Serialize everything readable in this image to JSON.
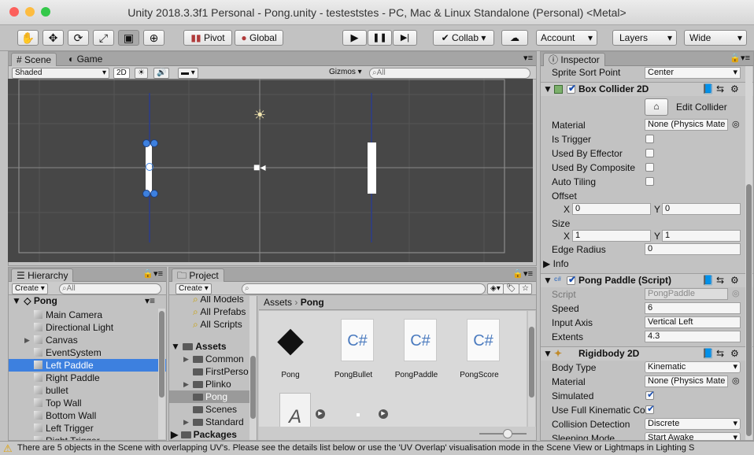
{
  "window": {
    "title": "Unity 2018.3.3f1 Personal - Pong.unity - testeststes - PC, Mac & Linux Standalone (Personal) <Metal>"
  },
  "colors": {
    "close": "#fc605c",
    "minimize": "#fdbc40",
    "maximize": "#34c84a",
    "selection": "#3d80df",
    "scene_bg": "#474747"
  },
  "toolbar": {
    "pivot": "Pivot",
    "global": "Global",
    "collab": "Collab",
    "account": "Account",
    "layers": "Layers",
    "layout": "Wide",
    "play_icon": "▶",
    "pause_icon": "❚❚",
    "step_icon": "▶|"
  },
  "scene": {
    "tab_scene": "Scene",
    "tab_game": "Game",
    "shading": "Shaded",
    "mode2d": "2D",
    "gizmos": "Gizmos",
    "search_placeholder": "All"
  },
  "hierarchy": {
    "tab": "Hierarchy",
    "create": "Create",
    "search_placeholder": "All",
    "scene_name": "Pong",
    "items": [
      "Main Camera",
      "Directional Light",
      "Canvas",
      "EventSystem",
      "Left Paddle",
      "Right Paddle",
      "bullet",
      "Top Wall",
      "Bottom Wall",
      "Left Trigger",
      "Right Trigger"
    ],
    "selected": "Left Paddle"
  },
  "project": {
    "tab": "Project",
    "create": "Create",
    "favorites": [
      "All Models",
      "All Prefabs",
      "All Scripts"
    ],
    "tree_root": "Assets",
    "tree": [
      "Common",
      "FirstPerso",
      "Plinko",
      "Pong",
      "Scenes",
      "Standard"
    ],
    "packages": "Packages",
    "breadcrumb_root": "Assets",
    "breadcrumb_current": "Pong",
    "assets": [
      "Pong",
      "PongBullet",
      "PongPaddle",
      "PongScore"
    ],
    "asset_glyph": "C#"
  },
  "inspector": {
    "tab": "Inspector",
    "sprite_sort_label": "Sprite Sort Point",
    "sprite_sort_value": "Center",
    "box_collider": {
      "title": "Box Collider 2D",
      "edit_collider": "Edit Collider",
      "material_label": "Material",
      "material_value": "None (Physics Mate",
      "is_trigger": "Is Trigger",
      "used_by_effector": "Used By Effector",
      "used_by_composite": "Used By Composite",
      "auto_tiling": "Auto Tiling",
      "offset": "Offset",
      "offset_x": "0",
      "offset_y": "0",
      "size": "Size",
      "size_x": "1",
      "size_y": "1",
      "edge_radius_label": "Edge Radius",
      "edge_radius": "0",
      "info": "Info",
      "x": "X",
      "y": "Y"
    },
    "paddle_script": {
      "title": "Pong Paddle (Script)",
      "script_label": "Script",
      "script_value": "PongPaddle",
      "speed_label": "Speed",
      "speed": "6",
      "axis_label": "Input Axis",
      "axis": "Vertical Left",
      "extents_label": "Extents",
      "extents": "4.3"
    },
    "rigidbody": {
      "title": "Rigidbody 2D",
      "body_type_label": "Body Type",
      "body_type": "Kinematic",
      "material_label": "Material",
      "material_value": "None (Physics Mate",
      "simulated_label": "Simulated",
      "full_kinematic_label": "Use Full Kinematic Co",
      "collision_label": "Collision Detection",
      "collision": "Discrete",
      "sleeping_label": "Sleeping Mode",
      "sleeping": "Start Awake"
    }
  },
  "status": {
    "message": "There are 5 objects in the Scene with overlapping UV's. Please see the details list below or use the 'UV Overlap' visualisation mode in the Scene View or Lightmaps in Lighting S"
  }
}
